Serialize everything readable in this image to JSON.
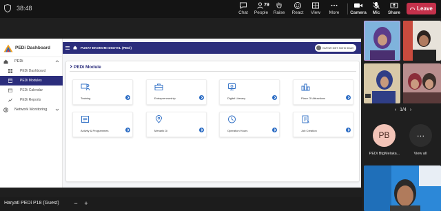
{
  "meeting": {
    "clock": "38:48",
    "toolbar": [
      {
        "id": "chat",
        "label": "Chat",
        "icon": "chat-icon"
      },
      {
        "id": "people",
        "label": "People",
        "icon": "people-icon",
        "count": "79"
      },
      {
        "id": "raise",
        "label": "Raise",
        "icon": "hand-icon"
      },
      {
        "id": "react",
        "label": "React",
        "icon": "smile-icon"
      },
      {
        "id": "view",
        "label": "View",
        "icon": "grid-icon"
      },
      {
        "id": "more",
        "label": "More",
        "icon": "more-icon"
      },
      {
        "id": "camera",
        "label": "Camera",
        "icon": "camera-icon"
      },
      {
        "id": "mic",
        "label": "Mic",
        "icon": "mic-icon"
      },
      {
        "id": "share",
        "label": "Share",
        "icon": "share-icon"
      }
    ],
    "leave_label": "Leave",
    "leave_color": "#c4314b",
    "page_indicator": "1/4",
    "participant_avatar_initials": "PB",
    "participant_avatar_name": "PEDi BtgMelaka...",
    "view_all_label": "View all",
    "guest_name": "Haryati PEDi P18 (Guest)",
    "zoom_out": "−",
    "zoom_in": "+"
  },
  "app": {
    "brand": "PEDi Dashboard",
    "header_title": "PUSAT EKONOMI DIGITAL (PEDi)",
    "user_name": "HARYATI BINTI MOHD SIDAH",
    "accent": "#2b2d7c",
    "nav": {
      "group_label": "PEDi",
      "items": [
        {
          "label": "PEDi Dashboard",
          "icon": "dashboard-icon"
        },
        {
          "label": "PEDi Modules",
          "icon": "modules-icon",
          "active": true
        },
        {
          "label": "PEDi Calendar",
          "icon": "calendar-icon"
        },
        {
          "label": "PEDi Reports",
          "icon": "reports-icon"
        }
      ],
      "network_label": "Network Monitoring"
    },
    "module_title": "PEDi Module",
    "modules": [
      {
        "label": "Training",
        "icon": "training-icon"
      },
      {
        "label": "Entrepreneurship",
        "icon": "briefcase-icon"
      },
      {
        "label": "Digital Literacy",
        "icon": "digital-literacy-icon"
      },
      {
        "label": "Place Of Attractions",
        "icon": "attractions-icon"
      },
      {
        "label": "Activity & Programmes",
        "icon": "activity-icon"
      },
      {
        "label": "Menarik Di",
        "icon": "location-pin-icon"
      },
      {
        "label": "Operation Hours",
        "icon": "clock-icon"
      },
      {
        "label": "Job Creation",
        "icon": "job-icon"
      }
    ]
  }
}
